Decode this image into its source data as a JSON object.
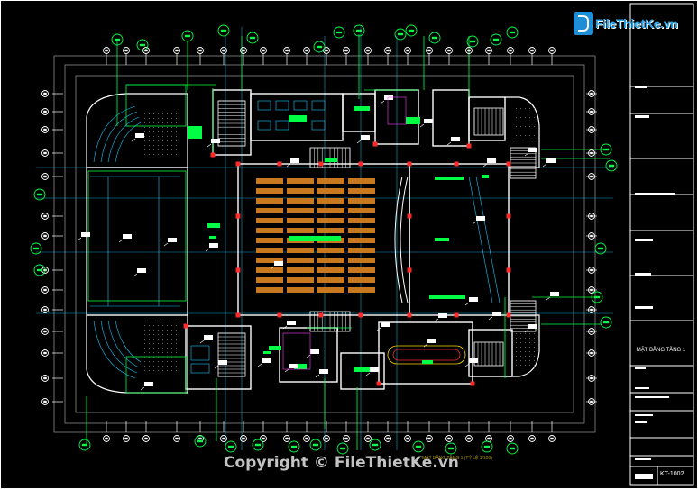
{
  "watermark": {
    "logo_text": "FileThietKe.vn",
    "copyright": "Copyright © FileThietKe.vn"
  },
  "title_block": {
    "sheet_title": "MẶT BẰNG TẦNG 1",
    "sheet_code": "KT-1002"
  },
  "plan_label": "MẶT BẰNG TẦNG 1 (TỶ LỆ 1/100)",
  "colors": {
    "background": "#000000",
    "walls": "#ffffff",
    "grid": "#19c8ff",
    "labels": "#00ff44",
    "seating": "#c8781e",
    "accent_red": "#ff2a2a",
    "yellow": "#ffd400",
    "magenta": "#ff40ff"
  }
}
